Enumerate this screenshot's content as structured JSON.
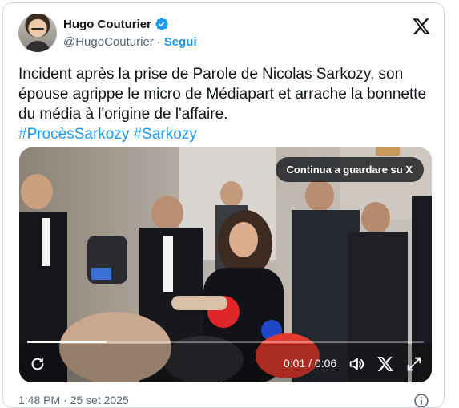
{
  "author": {
    "display_name": "Hugo Couturier",
    "handle": "@HugoCouturier",
    "separator": "·",
    "follow_label": "Segui",
    "verified_icon": "verified-badge-icon"
  },
  "tweet": {
    "text": "Incident après la prise de Parole de Nicolas Sarkozy, son épouse agrippe le micro de Médiapart et arrache la bonnette du média à l'origine de l'affaire.",
    "hashtags": "#ProcèsSarkozy #Sarkozy"
  },
  "video": {
    "continue_label": "Continua a guardare su X",
    "time_display": "0:01 / 0:06",
    "progress_fraction": 0.2,
    "controls": [
      "replay-icon",
      "volume-icon",
      "x-logo-icon",
      "fullscreen-icon"
    ]
  },
  "footer": {
    "timestamp": "1:48 PM · 25 set 2025",
    "info_icon": "info-icon"
  },
  "colors": {
    "accent": "#1d9bf0",
    "text": "#0f1419",
    "muted": "#536471",
    "border": "#cfd9de"
  }
}
